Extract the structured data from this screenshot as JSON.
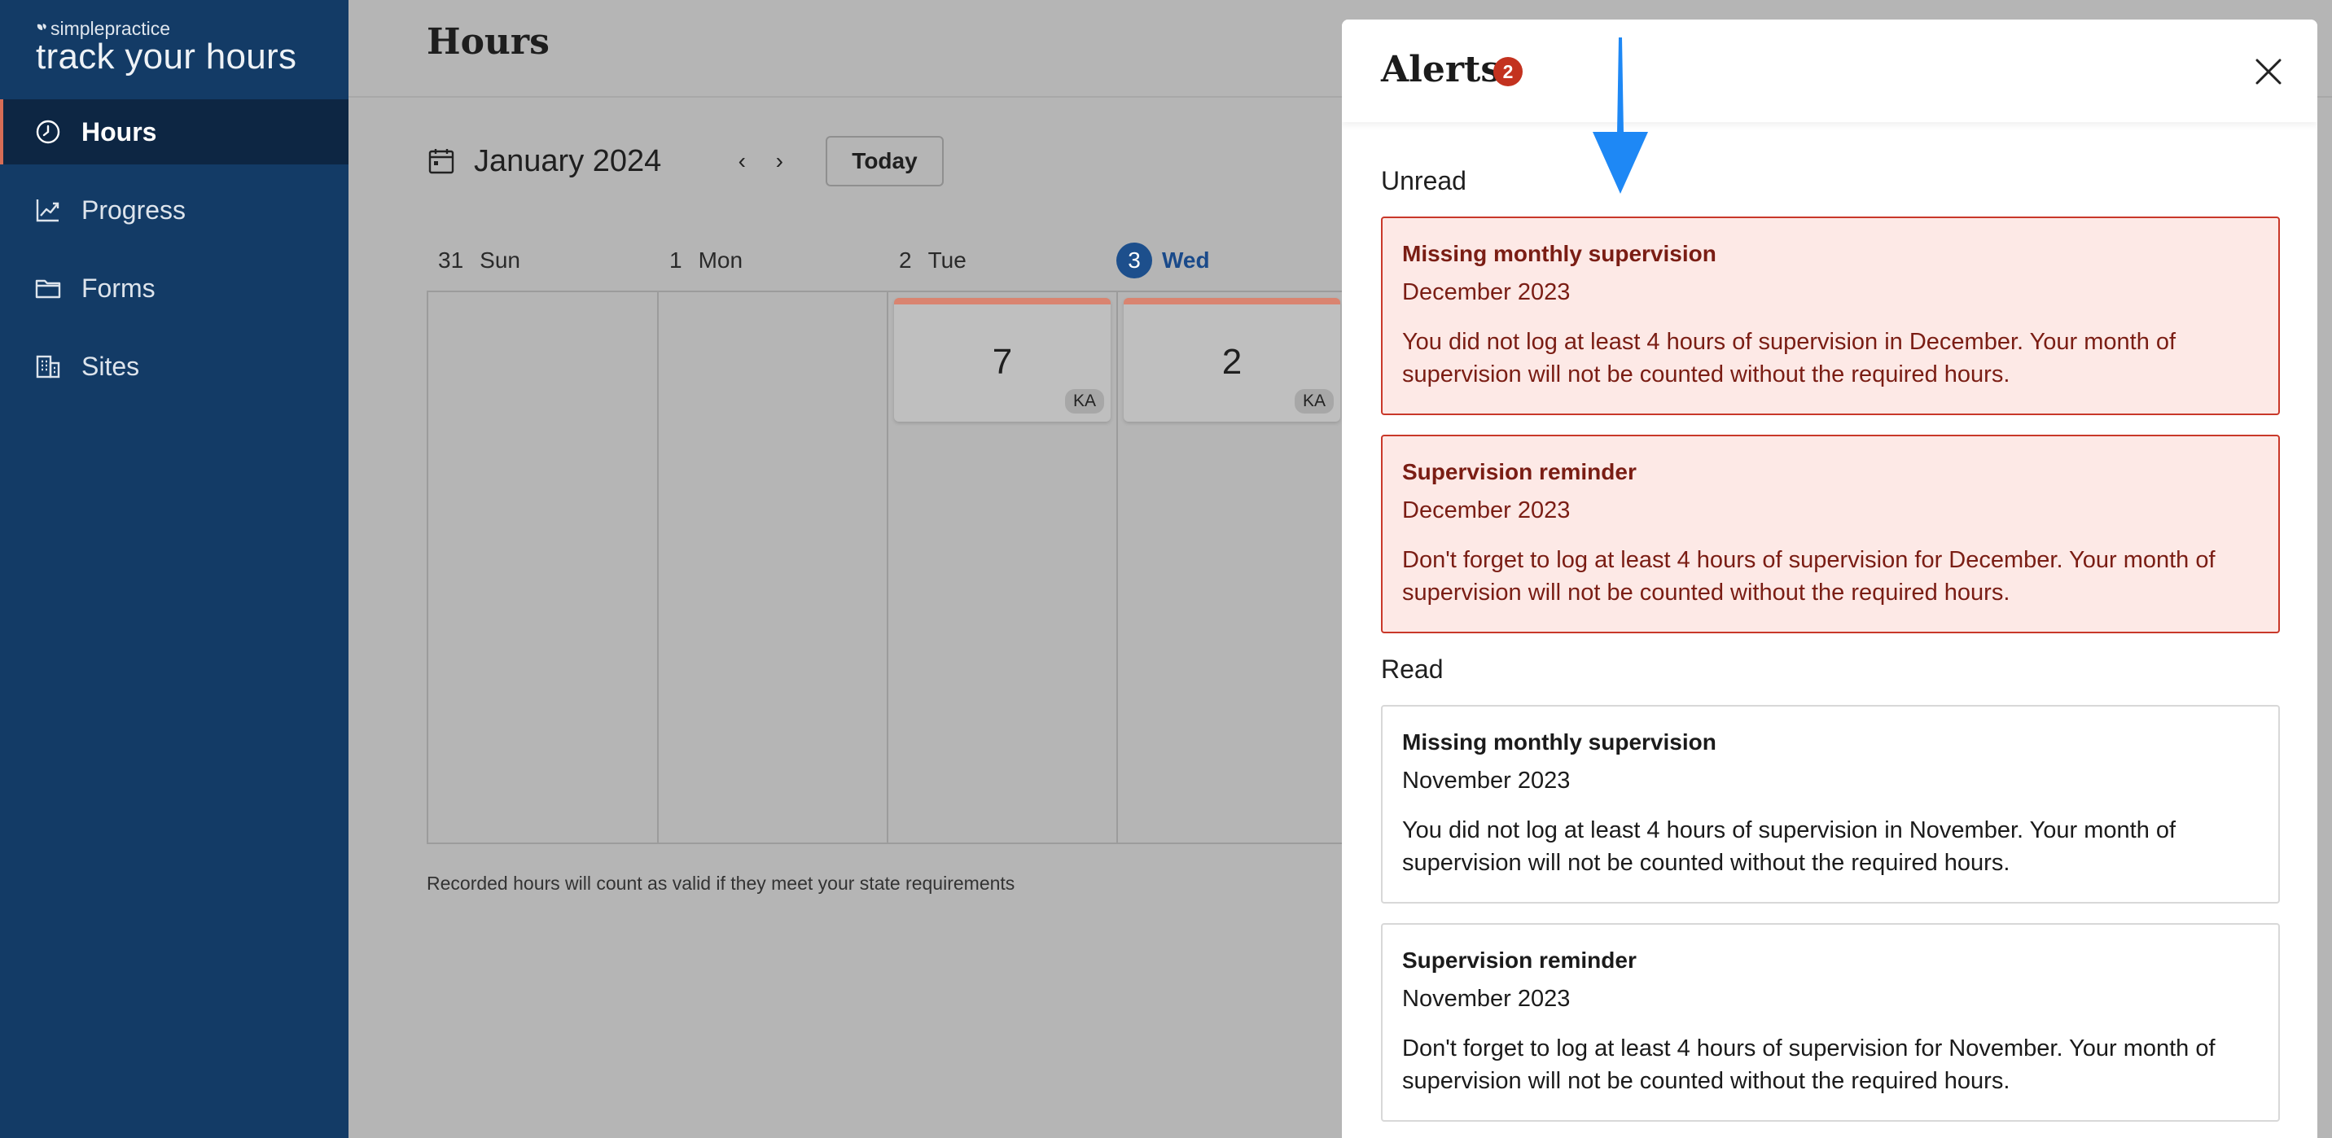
{
  "app": {
    "brand": "simplepractice",
    "tagline": "track your hours"
  },
  "sidebar": {
    "items": [
      {
        "label": "Hours",
        "icon": "clock-icon",
        "active": true
      },
      {
        "label": "Progress",
        "icon": "trend-chart-icon",
        "active": false
      },
      {
        "label": "Forms",
        "icon": "folder-icon",
        "active": false
      },
      {
        "label": "Sites",
        "icon": "building-icon",
        "active": false
      }
    ]
  },
  "main": {
    "title": "Hours",
    "calendar": {
      "month_label": "January 2024",
      "prev_label": "‹",
      "next_label": "›",
      "today_label": "Today",
      "days": [
        {
          "num": "31",
          "name": "Sun",
          "today": false
        },
        {
          "num": "1",
          "name": "Mon",
          "today": false
        },
        {
          "num": "2",
          "name": "Tue",
          "today": false
        },
        {
          "num": "3",
          "name": "Wed",
          "today": true
        }
      ],
      "entries": [
        {
          "day": "Tue",
          "hours": "7",
          "initials": "KA"
        },
        {
          "day": "Wed",
          "hours": "2",
          "initials": "KA"
        }
      ]
    },
    "footnote": "Recorded hours will count as valid if they meet your state requirements"
  },
  "alerts": {
    "title": "Alerts",
    "count": "2",
    "colors": {
      "unread_bg": "#fde9e6",
      "unread_border": "#c9382a",
      "badge": "#c3321f",
      "annotation_arrow": "#1e88f5"
    },
    "unread_label": "Unread",
    "read_label": "Read",
    "unread": [
      {
        "title": "Missing monthly supervision",
        "date": "December 2023",
        "body": "You did not log at least 4 hours of supervision in December. Your month of supervision will not be counted without the required hours."
      },
      {
        "title": "Supervision reminder",
        "date": "December 2023",
        "body": "Don't forget to log at least 4 hours of supervision for December. Your month of supervision will not be counted without the required hours."
      }
    ],
    "read": [
      {
        "title": "Missing monthly supervision",
        "date": "November 2023",
        "body": "You did not log at least 4 hours of supervision in November. Your month of supervision will not be counted without the required hours."
      },
      {
        "title": "Supervision reminder",
        "date": "November 2023",
        "body": "Don't forget to log at least 4 hours of supervision for November. Your month of supervision will not be counted without the required hours."
      }
    ]
  }
}
